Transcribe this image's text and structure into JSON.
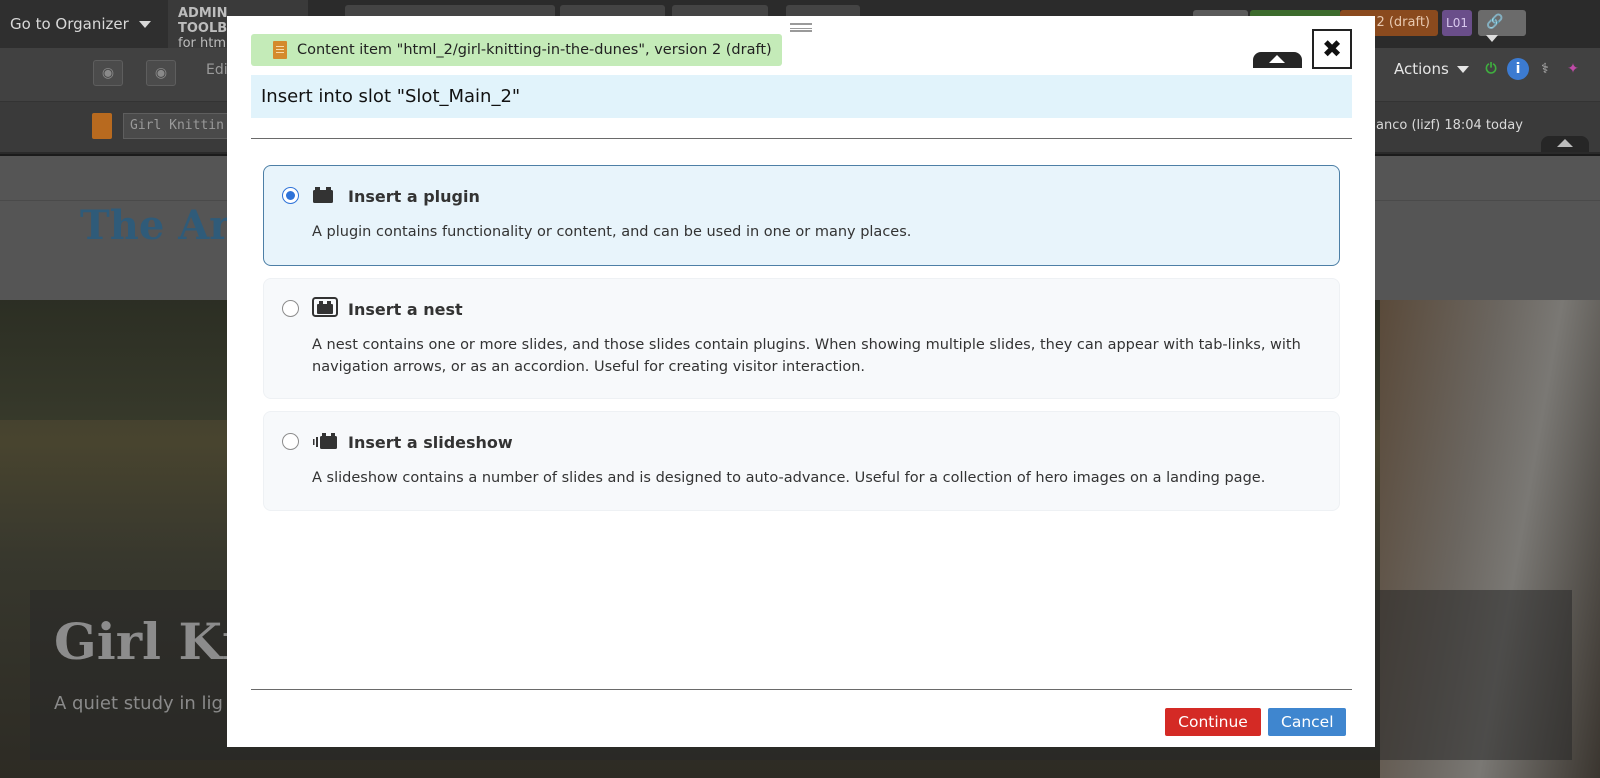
{
  "background": {
    "topbar": {
      "organizer_label": "Go to Organizer",
      "admin_toolbar_title": "ADMIN TOOLBAR",
      "admin_toolbar_sub": "for htm",
      "version_badge": "2 (draft)",
      "layout_badge": "L01"
    },
    "toolbar2": {
      "edit_label": "Edi",
      "actions_label": "Actions"
    },
    "toolbar3": {
      "title_value": "Girl Knittin",
      "last_edit": "anco (lizf) 18:04 today"
    },
    "site": {
      "title": "The Art",
      "hero_title": "Girl Kni",
      "hero_subtitle": "A quiet study in lig"
    }
  },
  "modal": {
    "content_badge": "Content item \"html_2/girl-knitting-in-the-dunes\", version 2 (draft)",
    "slot_heading": "Insert into slot \"Slot_Main_2\"",
    "options": [
      {
        "id": "plugin",
        "title": "Insert a plugin",
        "description": "A plugin contains functionality or content, and can be used in one or many places.",
        "selected": true,
        "icon": "plugin-icon"
      },
      {
        "id": "nest",
        "title": "Insert a nest",
        "description": "A nest contains one or more slides, and those slides contain plugins. When showing multiple slides, they can appear with tab-links, with navigation arrows, or as an accordion. Useful for creating visitor interaction.",
        "selected": false,
        "icon": "nest-icon"
      },
      {
        "id": "slideshow",
        "title": "Insert a slideshow",
        "description": "A slideshow contains a number of slides and is designed to auto-advance. Useful for a collection of hero images on a landing page.",
        "selected": false,
        "icon": "slideshow-icon"
      }
    ],
    "buttons": {
      "continue": "Continue",
      "cancel": "Cancel"
    },
    "close_glyph": "✖"
  },
  "colors": {
    "continue": "#d42a25",
    "cancel": "#3f86cf",
    "selected_border": "#4d7fa6",
    "slot_bar": "#e1f3fb",
    "content_badge": "#c4ebb8"
  }
}
